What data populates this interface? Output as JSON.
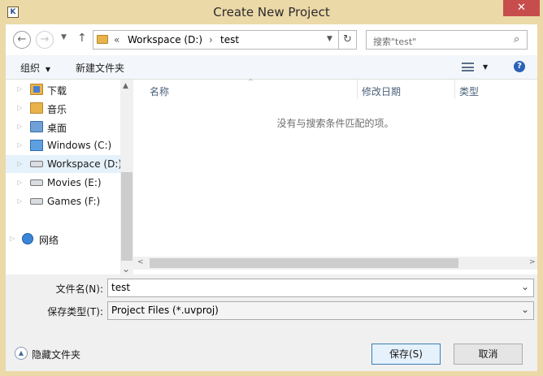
{
  "window": {
    "title": "Create New Project",
    "close_glyph": "✕"
  },
  "nav": {
    "back_glyph": "←",
    "forward_glyph": "→",
    "up_glyph": "↑",
    "breadcrumb_sep": "«",
    "breadcrumb": [
      "Workspace (D:)",
      "test"
    ],
    "crumb_arrow": "›",
    "refresh_glyph": "↻",
    "search_placeholder": "搜索\"test\"",
    "search_glyph": "⌕"
  },
  "toolbar": {
    "organize_label": "组织",
    "organize_caret": "▼",
    "new_folder_label": "新建文件夹",
    "view_caret": "▼",
    "help_glyph": "?"
  },
  "sidebar": {
    "items": [
      {
        "label": "下载",
        "icon": "download-folder-icon"
      },
      {
        "label": "音乐",
        "icon": "music-folder-icon"
      },
      {
        "label": "桌面",
        "icon": "desktop-folder-icon"
      },
      {
        "label": "Windows (C:)",
        "icon": "system-drive-icon"
      },
      {
        "label": "Workspace (D:)",
        "icon": "drive-icon",
        "selected": true
      },
      {
        "label": "Movies (E:)",
        "icon": "drive-icon"
      },
      {
        "label": "Games (F:)",
        "icon": "drive-icon"
      },
      {
        "label": "网络",
        "icon": "network-icon"
      }
    ],
    "expander_glyph": "▷"
  },
  "filelist": {
    "columns": [
      "名称",
      "修改日期",
      "类型"
    ],
    "sort_indicator": "^",
    "empty_message": "没有与搜索条件匹配的项。"
  },
  "scroll": {
    "up_glyph": "▲",
    "down_glyph": "⌄",
    "left_glyph": "<",
    "right_glyph": ">"
  },
  "form": {
    "filename_label": "文件名(N):",
    "filename_value": "test",
    "filetype_label": "保存类型(T):",
    "filetype_value": "Project Files (*.uvproj)",
    "dropdown_glyph": "⌄"
  },
  "footer": {
    "hide_folders_label": "隐藏文件夹",
    "hide_glyph": "▲",
    "save_label": "保存(S)",
    "cancel_label": "取消"
  }
}
